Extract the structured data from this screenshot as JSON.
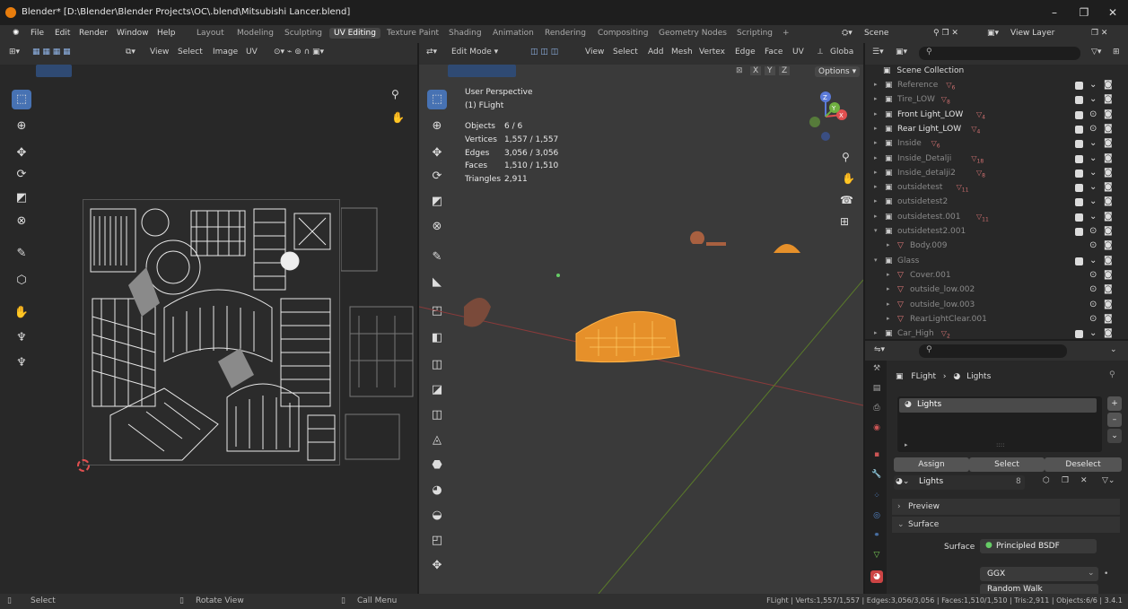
{
  "window": {
    "title": "Blender* [D:\\Blender\\Blender Projects\\OC\\.blend\\Mitsubishi Lancer.blend]",
    "controls": [
      "–",
      "❐",
      "✕"
    ]
  },
  "menu": {
    "items": [
      "File",
      "Edit",
      "Render",
      "Window",
      "Help"
    ],
    "workspaces": [
      "Layout",
      "Modeling",
      "Sculpting",
      "UV Editing",
      "Texture Paint",
      "Shading",
      "Animation",
      "Rendering",
      "Compositing",
      "Geometry Nodes",
      "Scripting"
    ],
    "active_workspace": "UV Editing",
    "add_tab": "+",
    "scene_label": "Scene",
    "view_layer_label": "View Layer"
  },
  "uv_editor": {
    "header_menus": [
      "View",
      "Select",
      "Image",
      "UV"
    ]
  },
  "viewport": {
    "mode": "Edit Mode",
    "header_menus": [
      "View",
      "Select",
      "Add",
      "Mesh",
      "Vertex",
      "Edge",
      "Face",
      "UV"
    ],
    "orientation": "Globa",
    "axis_buttons": [
      "X",
      "Y",
      "Z"
    ],
    "options_label": "Options",
    "overlay_title": "User Perspective",
    "overlay_object": "(1) FLight",
    "stats": [
      {
        "label": "Objects",
        "value": "6 / 6"
      },
      {
        "label": "Vertices",
        "value": "1,557 / 1,557"
      },
      {
        "label": "Edges",
        "value": "3,056 / 3,056"
      },
      {
        "label": "Faces",
        "value": "1,510 / 1,510"
      },
      {
        "label": "Triangles",
        "value": "2,911"
      }
    ],
    "gizmo_axes": [
      "Z",
      "Y",
      "X"
    ]
  },
  "outliner": {
    "root": "Scene Collection",
    "rows": [
      {
        "label": "Reference",
        "sub": "6",
        "dim": true
      },
      {
        "label": "Tire_LOW",
        "sub": "8",
        "dim": true
      },
      {
        "label": "Front Light_LOW",
        "sub": "4",
        "dim": false
      },
      {
        "label": "Rear Light_LOW",
        "sub": "4",
        "dim": false
      },
      {
        "label": "Inside",
        "sub": "6",
        "dim": true
      },
      {
        "label": "Inside_Detalji",
        "sub": "18",
        "dim": true
      },
      {
        "label": "Inside_detalji2",
        "sub": "8",
        "dim": true
      },
      {
        "label": "outsidetest",
        "sub": "11",
        "dim": true
      },
      {
        "label": "outsidetest2",
        "sub": "",
        "dim": true
      },
      {
        "label": "outsidetest.001",
        "sub": "11",
        "dim": true
      },
      {
        "label": "outsidetest2.001",
        "sub": "",
        "dim": true
      },
      {
        "label": "Body.009",
        "sub": "",
        "dim": true
      },
      {
        "label": "Glass",
        "sub": "",
        "dim": true
      },
      {
        "label": "Cover.001",
        "sub": "",
        "dim": true
      },
      {
        "label": "outside_low.002",
        "sub": "",
        "dim": true
      },
      {
        "label": "outside_low.003",
        "sub": "",
        "dim": true
      },
      {
        "label": "RearLightClear.001",
        "sub": "",
        "dim": true
      },
      {
        "label": "Car_High",
        "sub": "2",
        "dim": true
      }
    ]
  },
  "properties": {
    "breadcrumb_object": "FLight",
    "breadcrumb_sep": "›",
    "breadcrumb_material": "Lights",
    "slot_name": "Lights",
    "assign": "Assign",
    "select": "Select",
    "deselect": "Deselect",
    "material_name": "Lights",
    "material_users": "8",
    "preview": "Preview",
    "surface_section": "Surface",
    "surface_label": "Surface",
    "surface_value": "Principled BSDF",
    "distribution": "GGX",
    "subsurface_method": "Random Walk"
  },
  "status": {
    "select": "Select",
    "rotate": "Rotate View",
    "call_menu": "Call Menu",
    "stats": "FLight | Verts:1,557/1,557 | Edges:3,056/3,056 | Faces:1,510/1,510 | Tris:2,911 | Objects:6/6 | 3.4.1"
  }
}
